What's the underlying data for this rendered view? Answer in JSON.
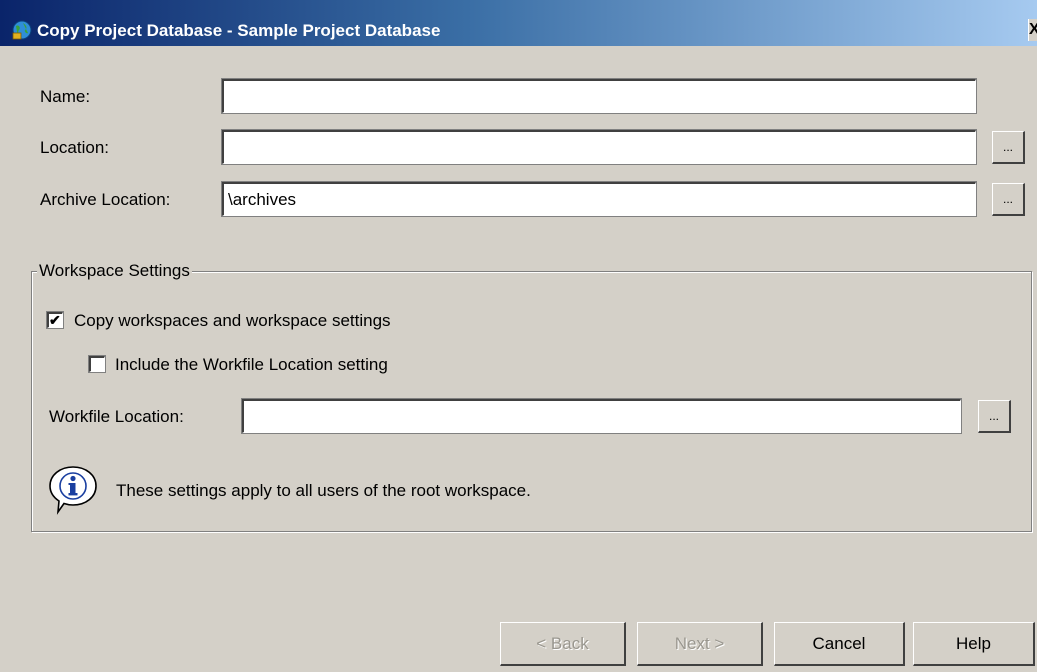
{
  "window": {
    "title": "Copy Project Database - Sample Project Database",
    "close_label": "X"
  },
  "form": {
    "name_label": "Name:",
    "name_value": "",
    "location_label": "Location:",
    "location_value": "",
    "archive_label": "Archive Location:",
    "archive_value": "\\archives",
    "browse_label": "..."
  },
  "workspace": {
    "legend": "Workspace Settings",
    "copy_label": "Copy workspaces and workspace settings",
    "copy_checked": true,
    "include_label": "Include the Workfile Location setting",
    "include_checked": false,
    "workfile_label": "Workfile Location:",
    "workfile_value": "",
    "info_text": "These settings apply to all users of the root workspace."
  },
  "buttons": {
    "back": "< Back",
    "next": "Next >",
    "cancel": "Cancel",
    "help": "Help"
  },
  "icons": {
    "app": "app-globe-icon",
    "info": "info-icon",
    "check": "checkmark-icon"
  },
  "colors": {
    "title_start": "#0a246a",
    "title_end": "#a6caf0",
    "face": "#d4d0c8",
    "disabled_text": "#9a978f"
  }
}
